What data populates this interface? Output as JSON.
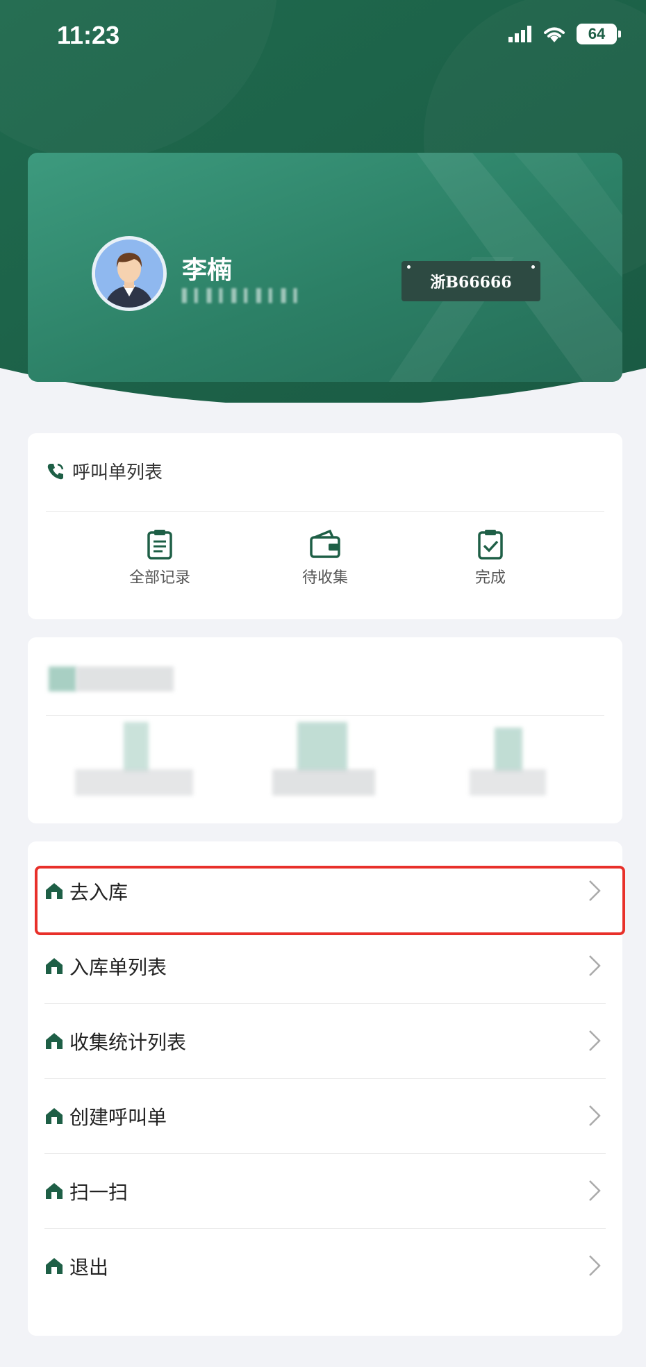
{
  "status_bar": {
    "time": "11:23",
    "battery": "64"
  },
  "profile": {
    "name": "李楠",
    "plate": "浙B66666",
    "avatar_icon": "user-avatar-icon"
  },
  "call_section": {
    "title": "呼叫单列表",
    "title_icon": "phone-icon",
    "stats": [
      {
        "label": "全部记录",
        "icon": "clipboard-icon"
      },
      {
        "label": "待收集",
        "icon": "wallet-icon"
      },
      {
        "label": "完成",
        "icon": "checked-clipboard-icon"
      }
    ]
  },
  "menu": {
    "items": [
      {
        "label": "去入库",
        "icon": "house-icon"
      },
      {
        "label": "入库单列表",
        "icon": "house-icon"
      },
      {
        "label": "收集统计列表",
        "icon": "house-icon"
      },
      {
        "label": "创建呼叫单",
        "icon": "house-icon"
      },
      {
        "label": "扫一扫",
        "icon": "house-icon"
      },
      {
        "label": "退出",
        "icon": "house-icon"
      }
    ]
  },
  "colors": {
    "brand_green": "#1e5f46",
    "accent_green": "#2c8066",
    "highlight_red": "#e8302a",
    "background": "#f2f3f7"
  }
}
